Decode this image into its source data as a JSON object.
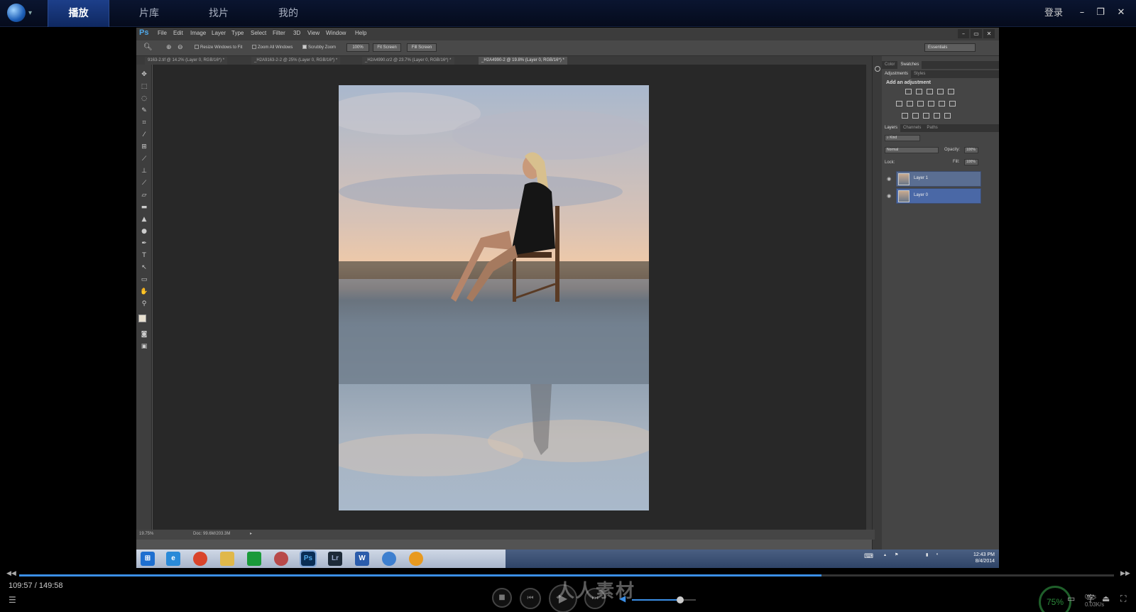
{
  "player": {
    "tabs": [
      "播放",
      "片库",
      "找片",
      "我的"
    ],
    "login": "登录",
    "time_current": "109:57",
    "time_sep": "/",
    "time_total": "149:58",
    "progress_fraction": 0.733,
    "volume_fraction": 0.75,
    "watermark": "人人素材",
    "cpu_percent": "75%",
    "net_up": "0K/s",
    "net_down": "0.03K/s",
    "icons": [
      "logo-icon",
      "minimize-icon",
      "restore-icon",
      "close-icon",
      "playlist-icon",
      "stop-icon",
      "prev-icon",
      "play-icon",
      "next-icon",
      "volume-icon",
      "screen-icon",
      "subtitle-icon",
      "eject-icon",
      "fullscreen-icon"
    ]
  },
  "photoshop": {
    "logo": "Ps",
    "menu": [
      "File",
      "Edit",
      "Image",
      "Layer",
      "Type",
      "Select",
      "Filter",
      "3D",
      "View",
      "Window",
      "Help"
    ],
    "window_buttons": [
      "–",
      "▭",
      "✕"
    ],
    "options": {
      "resize_windows": "Resize Windows to Fit",
      "zoom_all": "Zoom All Windows",
      "scrubby_zoom": "Scrubby Zoom",
      "btn_100": "100%",
      "fit_screen": "Fit Screen",
      "fill_screen": "Fill Screen",
      "workspace": "Essentials"
    },
    "doc_tabs": [
      "9163-2.tif @ 14.2% (Layer 0, RGB/16*) *",
      "_H2A9163-2-2 @ 25% (Layer 0, RGB/16*) *",
      "_H2A4990.cr2 @ 23.7% (Layer 0, RGB/16*) *",
      "_H2A4990-2 @ 19.8% (Layer 0, RGB/16*) *"
    ],
    "status": {
      "zoom": "19.75%",
      "doc": "Doc: 99.6M/203.3M"
    },
    "panels": {
      "top_tabs": [
        "Color",
        "Swatches"
      ],
      "adj_tabs": [
        "Adjustments",
        "Styles"
      ],
      "add_adjustment": "Add an adjustment",
      "layer_tabs": [
        "Layers",
        "Channels",
        "Paths"
      ],
      "kind": "Kind",
      "blend_mode": "Normal",
      "opacity_label": "Opacity:",
      "opacity_value": "100%",
      "lock_label": "Lock:",
      "fill_label": "Fill:",
      "fill_value": "100%",
      "layers": [
        "Layer 1",
        "Layer 0"
      ]
    }
  },
  "taskbar": {
    "apps": [
      {
        "name": "start-icon",
        "label": "",
        "color": "#1e6fd0"
      },
      {
        "name": "ie-icon",
        "label": "e",
        "color": "#2a8ad8"
      },
      {
        "name": "chrome-icon",
        "label": "",
        "color": "#d9442b"
      },
      {
        "name": "explorer-icon",
        "label": "",
        "color": "#e0b84a"
      },
      {
        "name": "store-icon",
        "label": "",
        "color": "#1a9a3a"
      },
      {
        "name": "app-icon",
        "label": "",
        "color": "#b84a4a"
      },
      {
        "name": "photoshop-icon",
        "label": "Ps",
        "color": "#0a2e55"
      },
      {
        "name": "lightroom-icon",
        "label": "Lr",
        "color": "#1d2a38"
      },
      {
        "name": "word-icon",
        "label": "W",
        "color": "#2b5cab"
      },
      {
        "name": "itunes-icon",
        "label": "",
        "color": "#3d7fcf"
      },
      {
        "name": "flower-icon",
        "label": "",
        "color": "#e89a20"
      }
    ],
    "time": "12:43 PM",
    "date": "8/4/2014"
  }
}
